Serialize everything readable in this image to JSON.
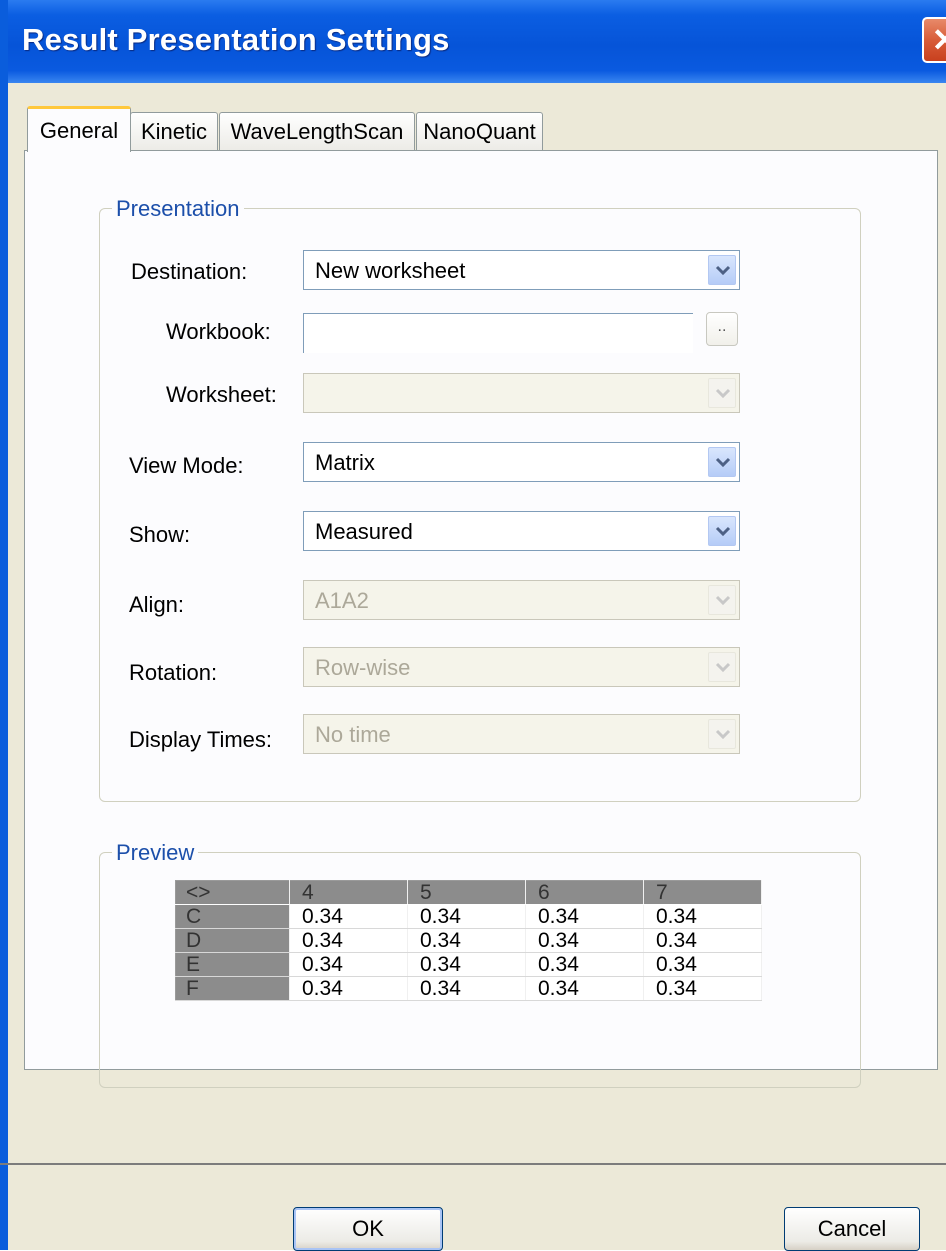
{
  "window": {
    "title": "Result Presentation Settings",
    "close_glyph": "✕"
  },
  "tabs": [
    {
      "label": "General",
      "active": true
    },
    {
      "label": "Kinetic",
      "active": false
    },
    {
      "label": "WaveLengthScan",
      "active": false
    },
    {
      "label": "NanoQuant",
      "active": false
    }
  ],
  "presentation": {
    "group_label": "Presentation",
    "destination": {
      "label": "Destination:",
      "value": "New worksheet"
    },
    "workbook": {
      "label": "Workbook:",
      "value": "",
      "browse_label": ".."
    },
    "worksheet": {
      "label": "Worksheet:",
      "value": ""
    },
    "view_mode": {
      "label": "View Mode:",
      "value": "Matrix"
    },
    "show": {
      "label": "Show:",
      "value": "Measured"
    },
    "align": {
      "label": "Align:",
      "value": "A1A2"
    },
    "rotation": {
      "label": "Rotation:",
      "value": "Row-wise"
    },
    "display_times": {
      "label": "Display Times:",
      "value": "No time"
    }
  },
  "preview": {
    "group_label": "Preview",
    "corner": "<>",
    "columns": [
      "4",
      "5",
      "6",
      "7"
    ],
    "rows": [
      {
        "label": "C",
        "values": [
          "0.34",
          "0.34",
          "0.34",
          "0.34"
        ]
      },
      {
        "label": "D",
        "values": [
          "0.34",
          "0.34",
          "0.34",
          "0.34"
        ]
      },
      {
        "label": "E",
        "values": [
          "0.34",
          "0.34",
          "0.34",
          "0.34"
        ]
      },
      {
        "label": "F",
        "values": [
          "0.34",
          "0.34",
          "0.34",
          "0.34"
        ]
      }
    ]
  },
  "buttons": {
    "ok": "OK",
    "cancel": "Cancel"
  },
  "colors": {
    "title_bar": "#0654d8",
    "group_label": "#1c4faa",
    "tab_highlight": "#ffc83c"
  }
}
